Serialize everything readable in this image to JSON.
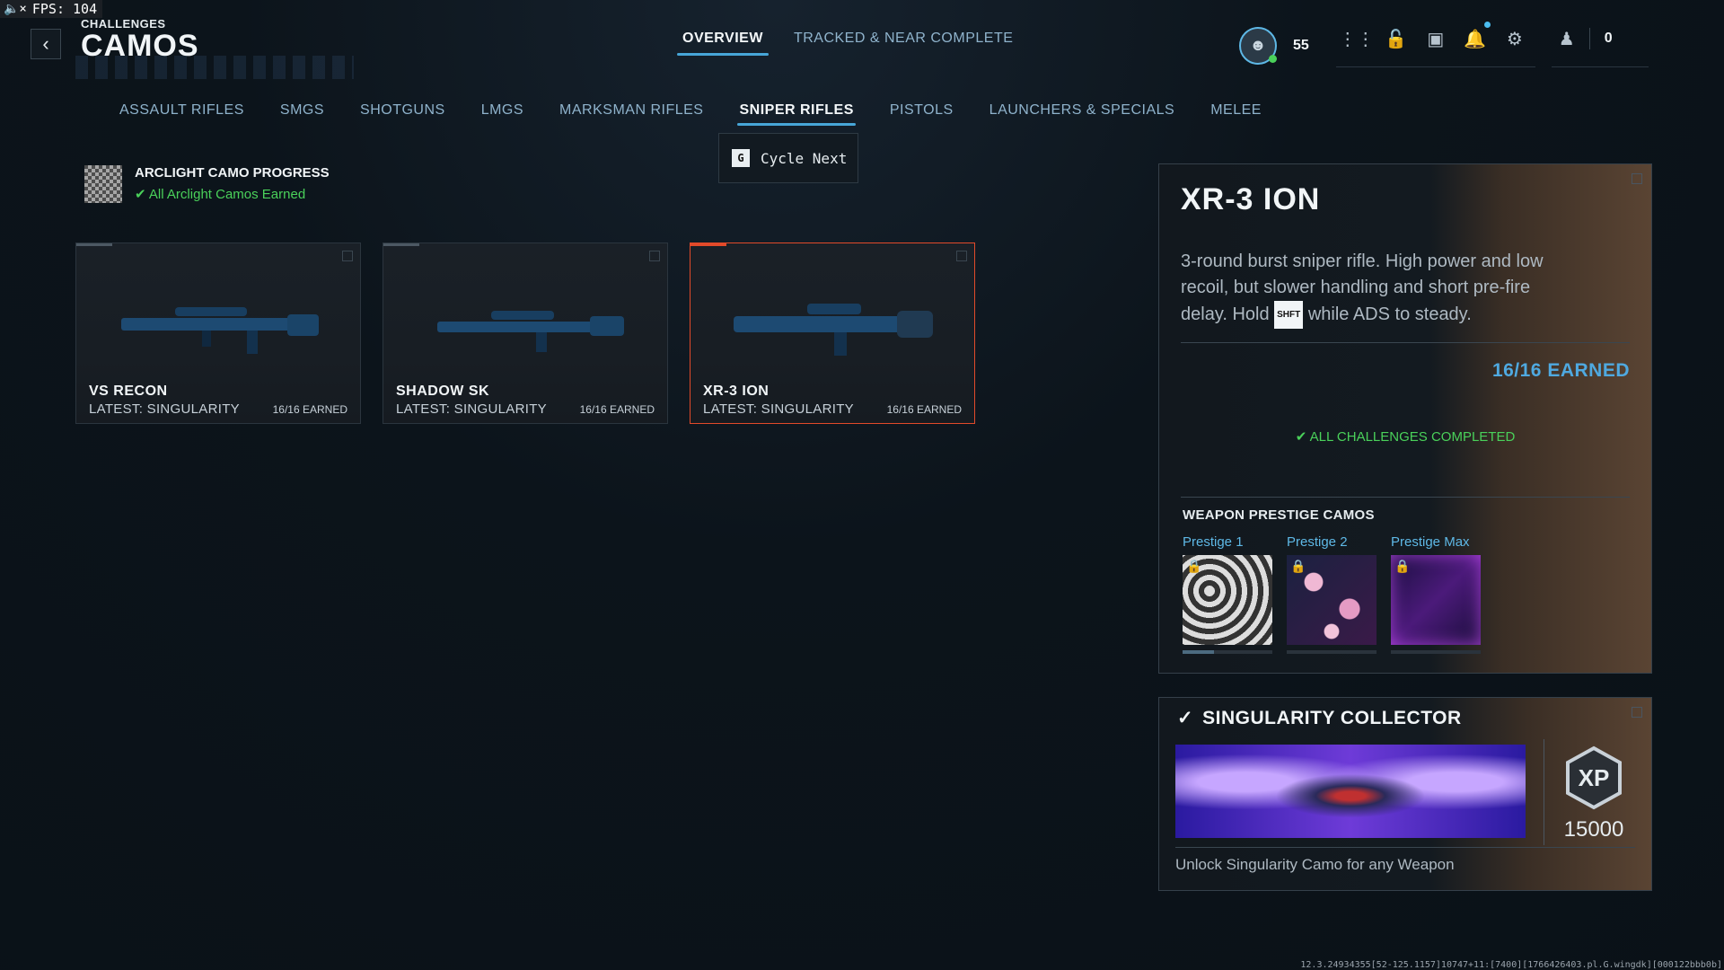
{
  "fps": {
    "label": "FPS: 104"
  },
  "header": {
    "breadcrumb": "CHALLENGES",
    "title": "CAMOS"
  },
  "top_tabs": [
    {
      "label": "OVERVIEW",
      "active": true
    },
    {
      "label": "TRACKED & NEAR COMPLETE",
      "active": false
    }
  ],
  "player": {
    "level": "55",
    "currency": "0"
  },
  "category_tabs": [
    {
      "label": "ASSAULT RIFLES"
    },
    {
      "label": "SMGS"
    },
    {
      "label": "SHOTGUNS"
    },
    {
      "label": "LMGS"
    },
    {
      "label": "MARKSMAN RIFLES"
    },
    {
      "label": "SNIPER RIFLES"
    },
    {
      "label": "PISTOLS"
    },
    {
      "label": "LAUNCHERS & SPECIALS"
    },
    {
      "label": "MELEE"
    }
  ],
  "active_category": "SNIPER RIFLES",
  "cycle_tip": {
    "key": "G",
    "label": "Cycle Next"
  },
  "arclight": {
    "title": "ARCLIGHT CAMO PROGRESS",
    "status": "All Arclight Camos Earned"
  },
  "weapons": [
    {
      "name": "VS RECON",
      "latest": "LATEST: SINGULARITY",
      "earned": "16/16 EARNED",
      "selected": false
    },
    {
      "name": "SHADOW SK",
      "latest": "LATEST: SINGULARITY",
      "earned": "16/16 EARNED",
      "selected": false
    },
    {
      "name": "XR-3 ION",
      "latest": "LATEST: SINGULARITY",
      "earned": "16/16 EARNED",
      "selected": true
    }
  ],
  "detail": {
    "name": "XR-3 ION",
    "desc_part1": "3-round burst sniper rifle. High power and low recoil, but slower handling and short pre-fire delay. Hold",
    "desc_key": "SHFT",
    "desc_part2": "while ADS to steady.",
    "earned": "16/16 EARNED",
    "all_challenges": "ALL CHALLENGES COMPLETED",
    "prestige_title": "WEAPON PRESTIGE CAMOS",
    "prestige": [
      {
        "label": "Prestige 1",
        "progress": 0.35
      },
      {
        "label": "Prestige 2",
        "progress": 0
      },
      {
        "label": "Prestige Max",
        "progress": 0
      }
    ]
  },
  "collector": {
    "title": "SINGULARITY COLLECTOR",
    "xp": "15000",
    "desc": "Unlock Singularity Camo for any Weapon"
  },
  "build_info": "12.3.24934355[52-125.1157]10747+11:[7400][1766426403.pl.G.wingdk][000122bbb0b]",
  "colors": {
    "accent": "#47a6d8",
    "selected_border": "#e24a2a",
    "success": "#4ad15a"
  }
}
